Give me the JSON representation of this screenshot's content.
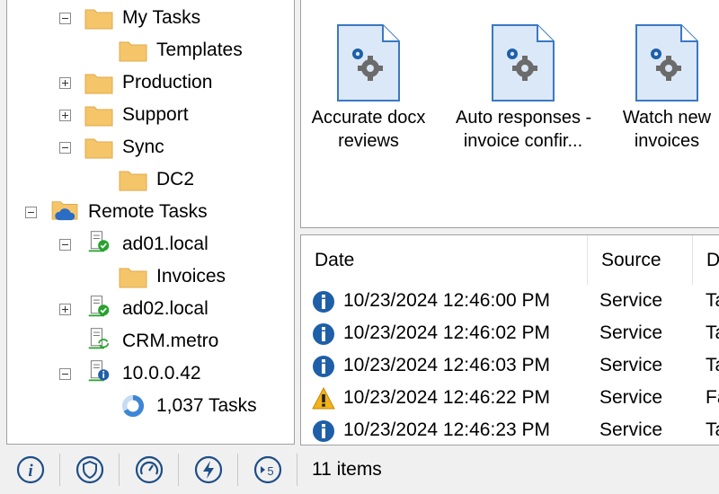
{
  "tree": {
    "items": [
      {
        "label": "My Tasks",
        "expander": "minus",
        "icon": "folder-icon"
      },
      {
        "label": "Templates",
        "expander": "",
        "icon": "folder-icon"
      },
      {
        "label": "Production",
        "expander": "plus",
        "icon": "folder-icon"
      },
      {
        "label": "Support",
        "expander": "plus",
        "icon": "folder-icon"
      },
      {
        "label": "Sync",
        "expander": "minus",
        "icon": "folder-icon"
      },
      {
        "label": "DC2",
        "expander": "",
        "icon": "folder-icon"
      },
      {
        "label": "Remote Tasks",
        "expander": "minus",
        "icon": "cloud-folder-icon"
      },
      {
        "label": "ad01.local",
        "expander": "minus",
        "icon": "server-ok-icon"
      },
      {
        "label": "Invoices",
        "expander": "",
        "icon": "folder-icon"
      },
      {
        "label": "ad02.local",
        "expander": "plus",
        "icon": "server-ok-icon"
      },
      {
        "label": "CRM.metro",
        "expander": "",
        "icon": "server-sync-icon"
      },
      {
        "label": "10.0.0.42",
        "expander": "minus",
        "icon": "server-info-icon"
      },
      {
        "label": "1,037 Tasks",
        "expander": "",
        "icon": "loading-ring-icon"
      }
    ]
  },
  "tasks": [
    {
      "line1": "Accurate docx",
      "line2": "reviews",
      "icon": "task-file-gears-icon"
    },
    {
      "line1": "Auto responses -",
      "line2": "invoice confir...",
      "icon": "task-file-gears-icon"
    },
    {
      "line1": "Watch new",
      "line2": "invoices",
      "icon": "task-file-gears-icon"
    }
  ],
  "log": {
    "columns": {
      "date": "Date",
      "source": "Source",
      "desc": "D"
    },
    "rows": [
      {
        "level": "info",
        "icon": "info-icon",
        "date": "10/23/2024 12:46:00 PM",
        "source": "Service",
        "desc": "Ta"
      },
      {
        "level": "info",
        "icon": "info-icon",
        "date": "10/23/2024 12:46:02 PM",
        "source": "Service",
        "desc": "Ta"
      },
      {
        "level": "info",
        "icon": "info-icon",
        "date": "10/23/2024 12:46:03 PM",
        "source": "Service",
        "desc": "Ta"
      },
      {
        "level": "warning",
        "icon": "warning-icon",
        "date": "10/23/2024 12:46:22 PM",
        "source": "Service",
        "desc": "Fa"
      },
      {
        "level": "info",
        "icon": "info-icon",
        "date": "10/23/2024 12:46:23 PM",
        "source": "Service",
        "desc": "Ta"
      }
    ]
  },
  "statusbar": {
    "buttons": [
      "info-icon",
      "shield-icon",
      "gauge-icon",
      "lightning-icon",
      "play-five-icon"
    ],
    "items_count": "11 items"
  },
  "colors": {
    "folder": "#f5c56a",
    "folder_dark": "#e0a94a",
    "accent_blue": "#1e5fa8",
    "ok_green": "#27a22d",
    "warning": "#f2b21b",
    "gear": "#6b6b6b",
    "panel_border": "#a0a0a0"
  }
}
